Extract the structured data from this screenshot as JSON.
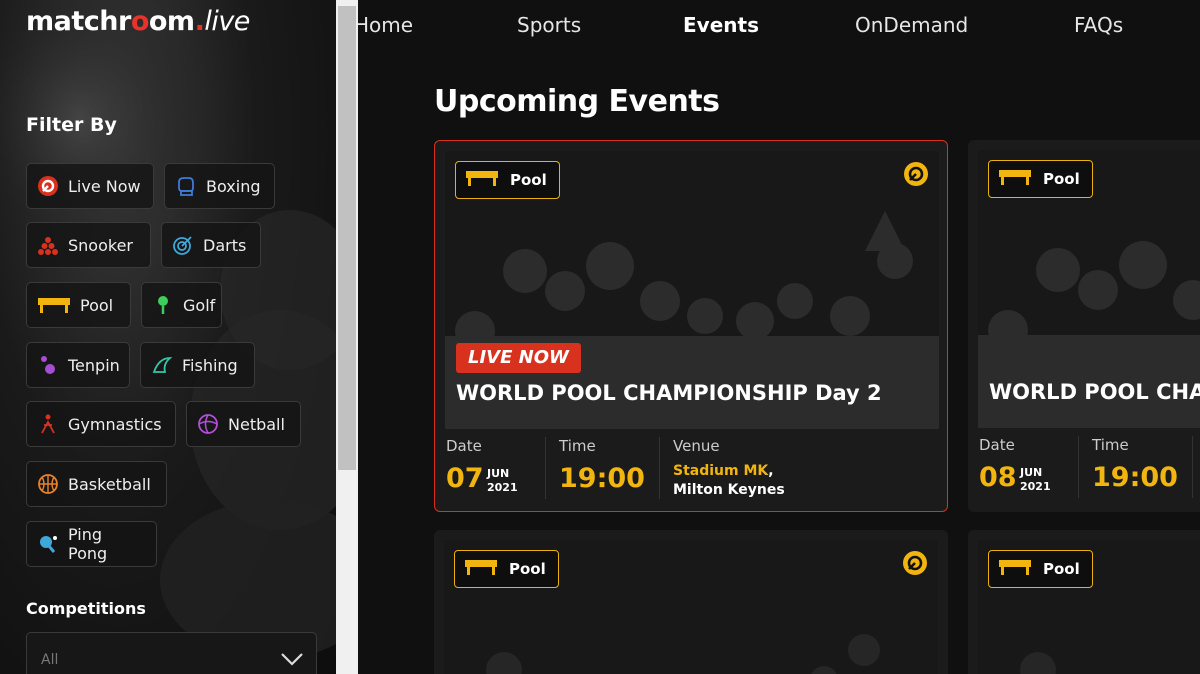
{
  "brand": {
    "name": "matchr",
    "name_rest": "om",
    "suffix": "live",
    "dot": "."
  },
  "sidebar": {
    "filter_title": "Filter By",
    "filters": [
      {
        "label": "Live Now",
        "icon": "live-now-icon"
      },
      {
        "label": "Boxing",
        "icon": "boxing-glove-icon"
      },
      {
        "label": "Snooker",
        "icon": "snooker-balls-icon"
      },
      {
        "label": "Darts",
        "icon": "dartboard-icon"
      },
      {
        "label": "Pool",
        "icon": "pool-table-icon"
      },
      {
        "label": "Golf",
        "icon": "golf-tee-icon"
      },
      {
        "label": "Tenpin",
        "icon": "bowling-pin-icon"
      },
      {
        "label": "Fishing",
        "icon": "fishing-icon"
      },
      {
        "label": "Gymnastics",
        "icon": "gymnastics-icon"
      },
      {
        "label": "Netball",
        "icon": "netball-icon"
      },
      {
        "label": "Basketball",
        "icon": "basketball-icon"
      },
      {
        "label": "Ping Pong",
        "icon": "ping-pong-paddle-icon"
      }
    ],
    "competitions_title": "Competitions",
    "competitions_value": "All"
  },
  "nav": [
    "Home",
    "Sports",
    "Events",
    "OnDemand",
    "FAQs"
  ],
  "nav_active": "Events",
  "main": {
    "heading": "Upcoming Events",
    "cards": [
      {
        "sport": "Pool",
        "live_label": "LIVE NOW",
        "title": "WORLD POOL CHAMPIONSHIP Day 2",
        "date_label": "Date",
        "day": "07",
        "month": "JUN",
        "year": "2021",
        "time_label": "Time",
        "time": "19:00",
        "venue_label": "Venue",
        "venue_name": "Stadium MK",
        "venue_comma": ",",
        "venue_city": "Milton Keynes"
      },
      {
        "sport": "Pool",
        "title": "WORLD POOL CHAM",
        "date_label": "Date",
        "day": "08",
        "month": "JUN",
        "year": "2021",
        "time_label": "Time",
        "time": "19:00"
      },
      {
        "sport": "Pool"
      },
      {
        "sport": "Pool"
      }
    ]
  },
  "colors": {
    "accent": "#f2b50f",
    "live": "#d8321f",
    "bg": "#101010"
  }
}
